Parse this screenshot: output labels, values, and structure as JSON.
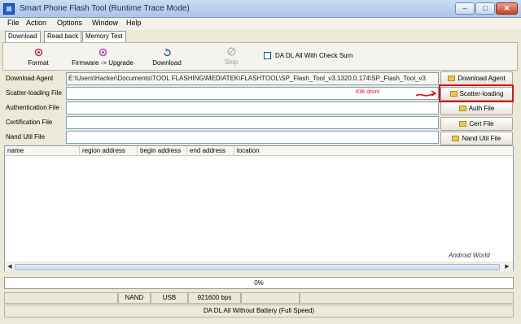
{
  "window": {
    "title": "Smart Phone Flash Tool (Runtime Trace Mode)",
    "controls": {
      "minimize": "–",
      "maximize": "□",
      "close": "✕"
    }
  },
  "menu": [
    "File",
    "Action",
    "Options",
    "Window",
    "Help"
  ],
  "tabs": [
    "Download",
    "Read back",
    "Memory Test"
  ],
  "toolbar": {
    "format": "Format",
    "firmware_upgrade": "Firmware -> Upgrade",
    "download": "Download",
    "stop": "Stop",
    "checkbox_label": "DA DL All With Check Sum",
    "checkbox_checked": false
  },
  "files": {
    "download_agent": {
      "label": "Download Agent",
      "value": "E:\\Users\\Hacker\\Documents\\TOOL FLASHING\\MEDIATEK\\FLASHTOOL\\SP_Flash_Tool_v3.1320.0.174\\SP_Flash_Tool_v3",
      "button": "Download Agent"
    },
    "scatter": {
      "label": "Scatter-loading File",
      "value": "",
      "button": "Scatter-loading"
    },
    "auth": {
      "label": "Authentication File",
      "value": "",
      "button": "Auth File"
    },
    "cert": {
      "label": "Certification File",
      "value": "",
      "button": "Cert File"
    },
    "nand": {
      "label": "Nand Util File",
      "value": "",
      "button": "Nand Util File"
    }
  },
  "annotation": {
    "text": "Klik disini",
    "color": "#d0161c"
  },
  "list": {
    "columns": [
      "name",
      "region address",
      "begin address",
      "end address",
      "location"
    ],
    "rows": [],
    "watermark": "Android World"
  },
  "progress": {
    "value": 0,
    "label": "0%",
    "bar_color": "#3a9c3a"
  },
  "status": {
    "cells": [
      "",
      "NAND",
      "USB",
      "921600 bps",
      "",
      ""
    ],
    "mode": "DA DL All Without Battery (Full Speed)"
  }
}
